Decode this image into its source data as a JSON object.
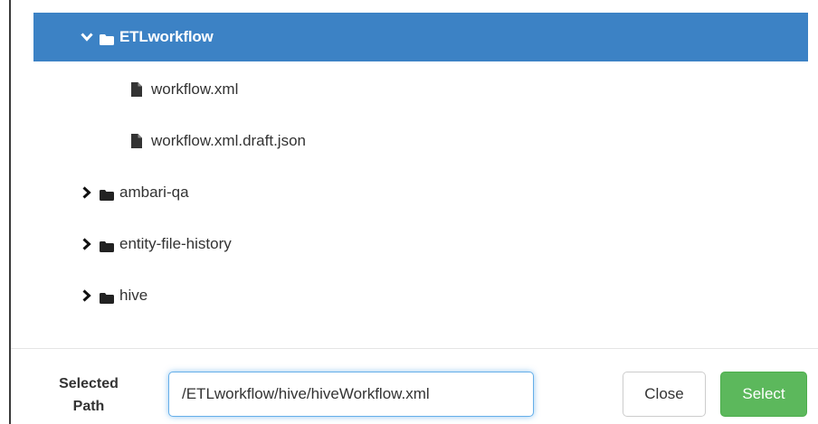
{
  "tree": {
    "selected_folder": {
      "label": "ETLworkflow",
      "icon": "folder-icon",
      "expanded": true
    },
    "children": [
      {
        "label": "workflow.xml",
        "icon": "file-icon"
      },
      {
        "label": "workflow.xml.draft.json",
        "icon": "file-icon"
      }
    ],
    "folders": [
      {
        "label": "ambari-qa",
        "icon": "folder-icon",
        "expanded": false
      },
      {
        "label": "entity-file-history",
        "icon": "folder-icon",
        "expanded": false
      },
      {
        "label": "hive",
        "icon": "folder-icon",
        "expanded": false
      }
    ]
  },
  "footer": {
    "selected_path_label_line1": "Selected",
    "selected_path_label_line2": "Path",
    "selected_path_value": "/ETLworkflow/hive/hiveWorkflow.xml",
    "close_label": "Close",
    "select_label": "Select"
  },
  "colors": {
    "selected_row": "#3c82c5",
    "select_button": "#5cb85c",
    "input_focus": "#66afe9"
  }
}
